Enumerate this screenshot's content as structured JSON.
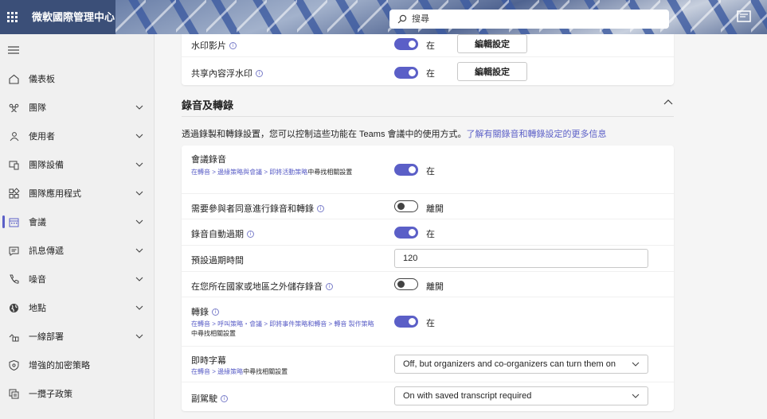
{
  "app": {
    "title": "微軟國際管理中心"
  },
  "search": {
    "placeholder": "搜尋"
  },
  "sidebar": {
    "items": [
      {
        "label": "儀表板",
        "icon": "home-icon",
        "has_chevron": false
      },
      {
        "label": "團隊",
        "icon": "teams-icon",
        "has_chevron": true
      },
      {
        "label": "使用者",
        "icon": "users-icon",
        "has_chevron": true
      },
      {
        "label": "團隊設備",
        "icon": "devices-icon",
        "has_chevron": true
      },
      {
        "label": "團隊應用程式",
        "icon": "apps-icon",
        "has_chevron": true
      },
      {
        "label": "會議",
        "icon": "calendar-icon",
        "has_chevron": true,
        "active": true
      },
      {
        "label": "訊息傳遞",
        "icon": "chat-icon",
        "has_chevron": true
      },
      {
        "label": "噪音",
        "icon": "phone-icon",
        "has_chevron": true
      },
      {
        "label": "地點",
        "icon": "globe-icon",
        "has_chevron": true
      },
      {
        "label": "一線部署",
        "icon": "frontline-icon",
        "has_chevron": true
      },
      {
        "label": "增強的加密策略",
        "icon": "shield-icon",
        "has_chevron": false
      },
      {
        "label": "一攬子政策",
        "icon": "policy-package-icon",
        "has_chevron": false
      }
    ]
  },
  "watermark_card": {
    "rows": [
      {
        "name": "水印影片",
        "toggle": "在",
        "button": "編輯設定"
      },
      {
        "name": "共享內容浮水印",
        "toggle": "在",
        "button": "編輯設定"
      }
    ]
  },
  "section": {
    "title": "錄音及轉錄",
    "desc_text": "透過錄製和轉錄設置，您可以控制這些功能在 Teams 會議中的使用方式。",
    "desc_link": "了解有關錄音和轉錄設定的更多信息"
  },
  "settings": {
    "meeting_recording": {
      "name": "會議錄音",
      "path_link": "在轉音 > 邊緣策略與會議 > 即將活動策略",
      "path_plain": "中尋找相關設置",
      "toggle_label": "在"
    },
    "require_consent": {
      "name": "需要參與者同意進行錄音和轉錄",
      "toggle_label": "離開"
    },
    "auto_expire": {
      "name": "錄音自動過期",
      "toggle_label": "在"
    },
    "default_expiry": {
      "name": "預設過期時間",
      "value": "120"
    },
    "store_outside": {
      "name": "在您所在國家或地區之外儲存錄音",
      "toggle_label": "離開"
    },
    "transcription": {
      "name": "轉錄",
      "path_link": "在轉音 > 呼叫策略・會議 > 即將事件策略和轉音 > 轉音 製作策略",
      "path_plain": "中尋找相關設置",
      "toggle_label": "在"
    },
    "live_captions": {
      "name": "即時字幕",
      "path_link": "在轉音 > 邊緣策略",
      "path_plain": "中尋找相關設置",
      "value": "Off, but organizers and co-organizers can turn them on"
    },
    "copilot": {
      "name": "副駕駛",
      "value": "On with saved transcript required"
    }
  },
  "colors": {
    "accent": "#5b5fc7",
    "topbar": "#3b4f78"
  }
}
